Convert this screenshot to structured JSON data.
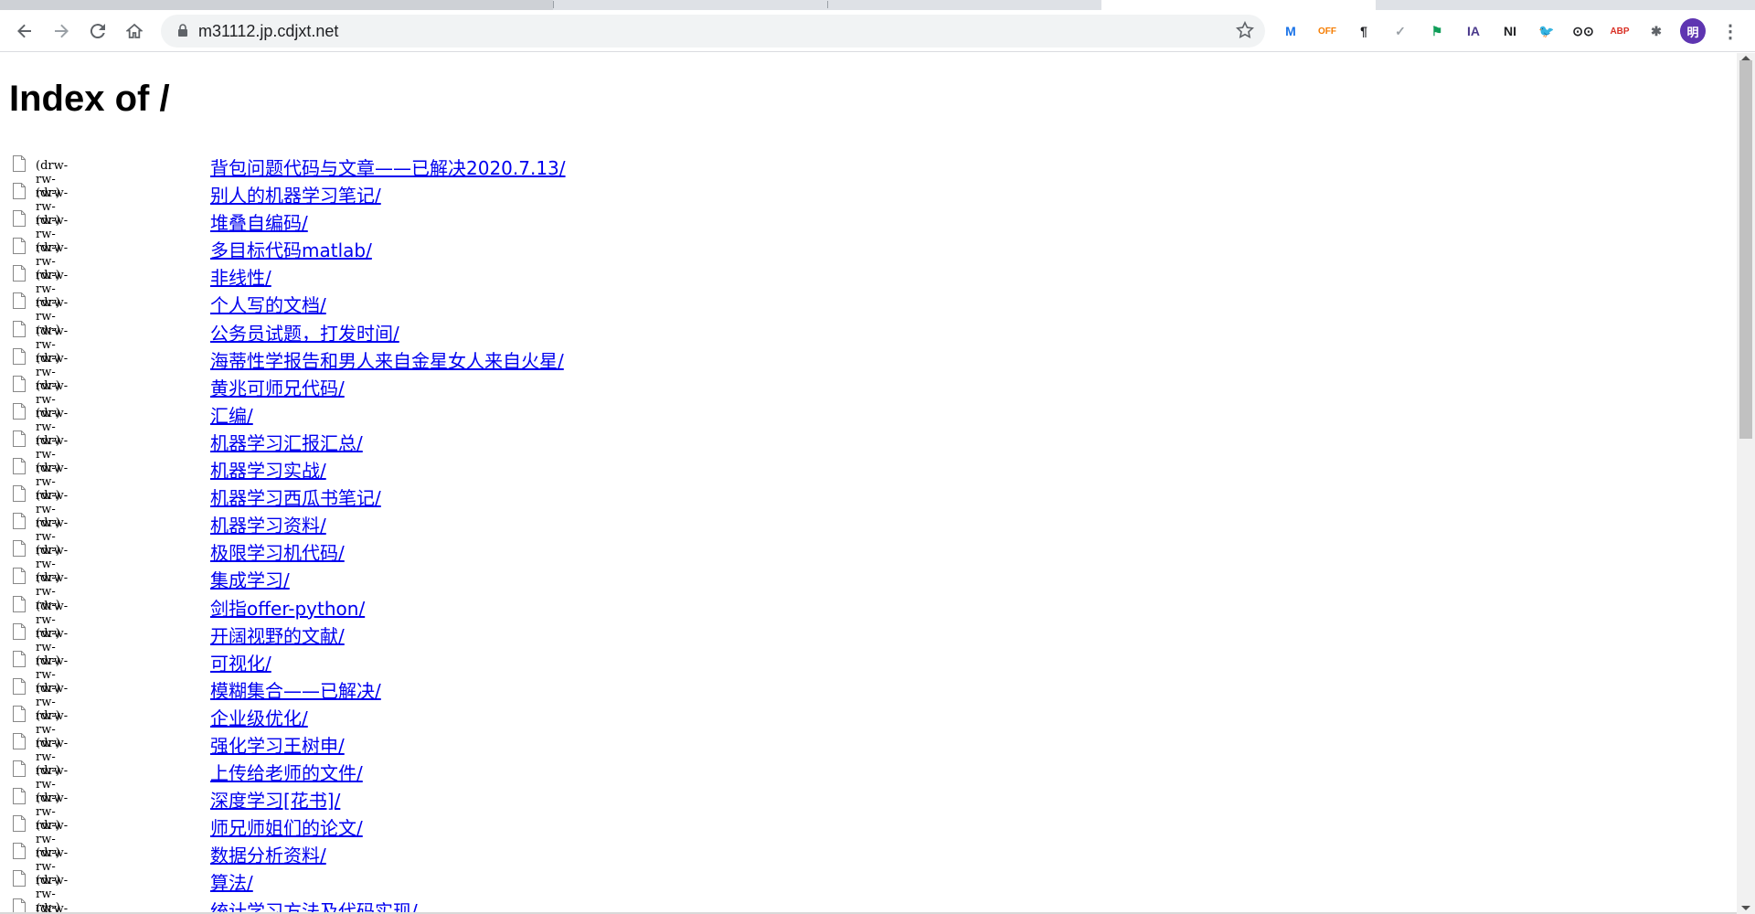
{
  "browser": {
    "url": "m31112.jp.cdjxt.net",
    "back_icon": "arrow-left-icon",
    "forward_icon": "arrow-right-icon",
    "reload_icon": "reload-icon",
    "home_icon": "home-icon",
    "extensions": [
      {
        "name": "m-extension-icon",
        "label": "M",
        "color": "#1a73e8"
      },
      {
        "name": "off-extension-icon",
        "label": "OFF",
        "color": "#f57c00"
      },
      {
        "name": "pilcrow-extension-icon",
        "label": "¶",
        "color": "#202124"
      },
      {
        "name": "check-extension-icon",
        "label": "✓",
        "color": "#9aa0a6"
      },
      {
        "name": "flag-extension-icon",
        "label": "⚑",
        "color": "#0f9d58"
      },
      {
        "name": "ia-extension-icon",
        "label": "IA",
        "color": "#4b3a8c"
      },
      {
        "name": "ni-extension-icon",
        "label": "NI",
        "color": "#202124"
      },
      {
        "name": "bird-extension-icon",
        "label": "🐦",
        "color": "#202124"
      },
      {
        "name": "glasses-extension-icon",
        "label": "⊙⊙",
        "color": "#202124"
      },
      {
        "name": "abp-extension-icon",
        "label": "ABP",
        "color": "#d93025"
      },
      {
        "name": "puzzle-extensions-icon",
        "label": "✱",
        "color": "#5f6368"
      }
    ],
    "profile_label": "明",
    "profile_color": "#5e35b1"
  },
  "page": {
    "title": "Index of /",
    "entries": [
      {
        "perm": "(drw-rw-rw-)",
        "name": "背包问题代码与文章——已解决2020.7.13/"
      },
      {
        "perm": "(drw-rw-rw-)",
        "name": "别人的机器学习笔记/"
      },
      {
        "perm": "(drw-rw-rw-)",
        "name": "堆叠自编码/"
      },
      {
        "perm": "(drw-rw-rw-)",
        "name": "多目标代码matlab/"
      },
      {
        "perm": "(drw-rw-rw-)",
        "name": "非线性/"
      },
      {
        "perm": "(drw-rw-rw-)",
        "name": "个人写的文档/"
      },
      {
        "perm": "(drw-rw-rw-)",
        "name": "公务员试题，打发时间/"
      },
      {
        "perm": "(drw-rw-rw-)",
        "name": "海蒂性学报告和男人来自金星女人来自火星/"
      },
      {
        "perm": "(drw-rw-rw-)",
        "name": "黄兆可师兄代码/"
      },
      {
        "perm": "(drw-rw-rw-)",
        "name": "汇编/"
      },
      {
        "perm": "(drw-rw-rw-)",
        "name": "机器学习汇报汇总/"
      },
      {
        "perm": "(drw-rw-rw-)",
        "name": "机器学习实战/"
      },
      {
        "perm": "(drw-rw-rw-)",
        "name": "机器学习西瓜书笔记/"
      },
      {
        "perm": "(drw-rw-rw-)",
        "name": "机器学习资料/"
      },
      {
        "perm": "(drw-rw-rw-)",
        "name": "极限学习机代码/"
      },
      {
        "perm": "(drw-rw-rw-)",
        "name": "集成学习/"
      },
      {
        "perm": "(drw-rw-rw-)",
        "name": "剑指offer-python/"
      },
      {
        "perm": "(drw-rw-rw-)",
        "name": "开阔视野的文献/"
      },
      {
        "perm": "(drw-rw-rw-)",
        "name": "可视化/"
      },
      {
        "perm": "(drw-rw-rw-)",
        "name": "模糊集合——已解决/"
      },
      {
        "perm": "(drw-rw-rw-)",
        "name": "企业级优化/"
      },
      {
        "perm": "(drw-rw-rw-)",
        "name": "强化学习王树申/"
      },
      {
        "perm": "(drw-rw-rw-)",
        "name": "上传给老师的文件/"
      },
      {
        "perm": "(drw-rw-rw-)",
        "name": "深度学习[花书]/"
      },
      {
        "perm": "(drw-rw-rw-)",
        "name": "师兄师姐们的论文/"
      },
      {
        "perm": "(drw-rw-rw-)",
        "name": "数据分析资料/"
      },
      {
        "perm": "(drw-rw-rw-)",
        "name": "算法/"
      },
      {
        "perm": "(drw-rw-rw-)",
        "name": "统计学习方法及代码实现/"
      }
    ]
  }
}
